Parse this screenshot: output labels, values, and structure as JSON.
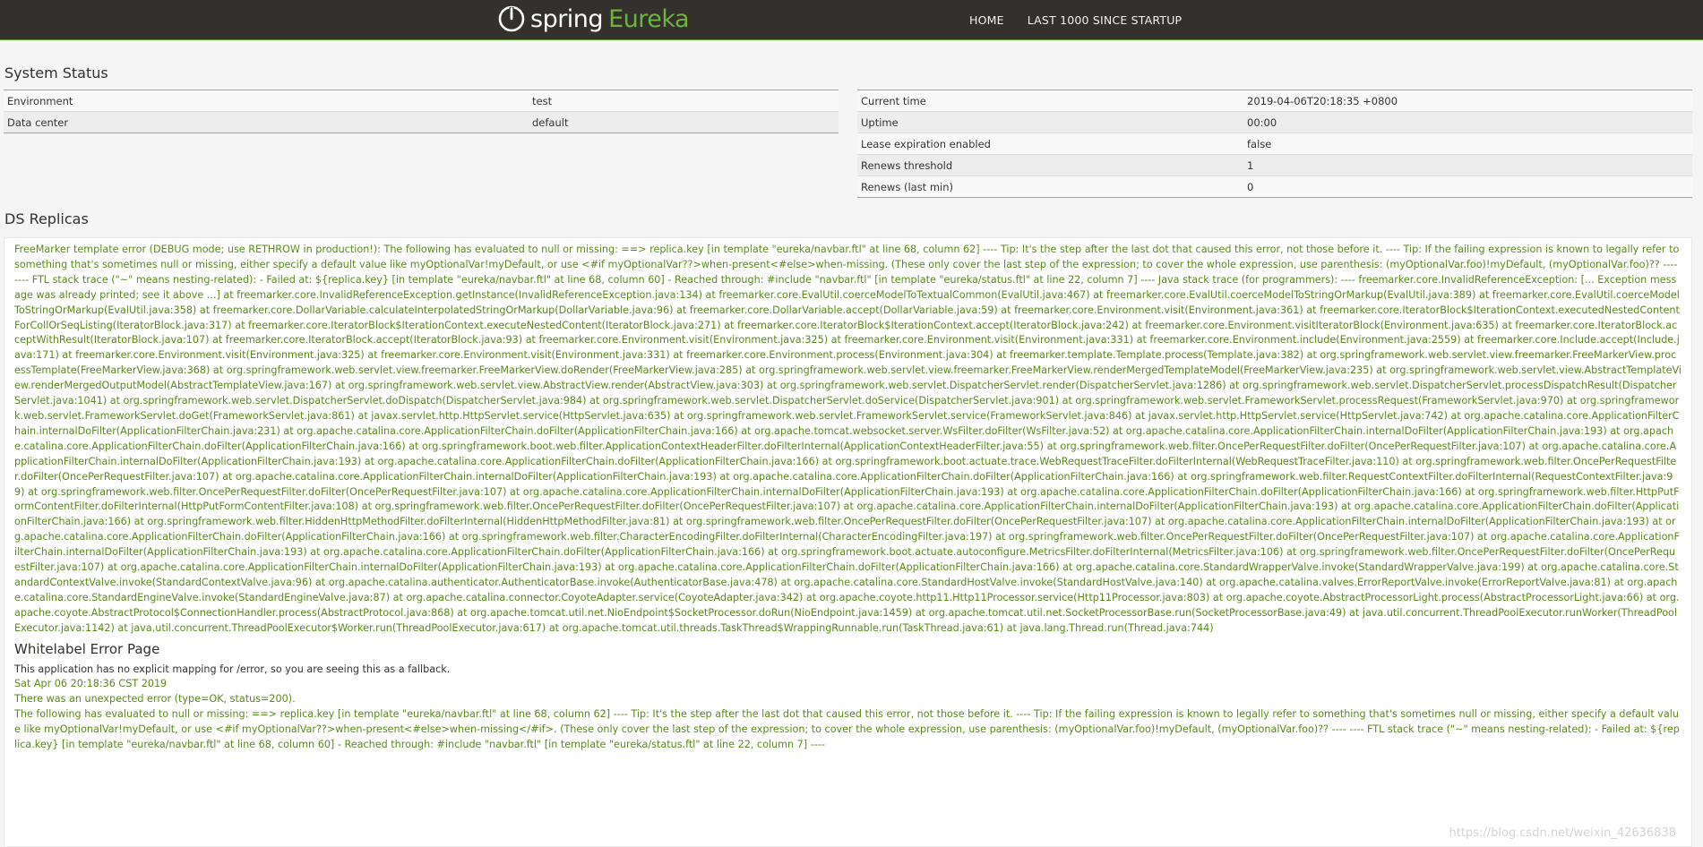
{
  "navbar": {
    "brand_spring": "spring",
    "brand_eureka": "Eureka",
    "links": [
      "HOME",
      "LAST 1000 SINCE STARTUP"
    ]
  },
  "system_status": {
    "title": "System Status",
    "left": [
      {
        "key": "Environment",
        "value": "test"
      },
      {
        "key": "Data center",
        "value": "default"
      }
    ],
    "right": [
      {
        "key": "Current time",
        "value": "2019-04-06T20:18:35 +0800"
      },
      {
        "key": "Uptime",
        "value": "00:00"
      },
      {
        "key": "Lease expiration enabled",
        "value": "false"
      },
      {
        "key": "Renews threshold",
        "value": "1"
      },
      {
        "key": "Renews (last min)",
        "value": "0"
      }
    ]
  },
  "replicas": {
    "title": "DS Replicas",
    "error_trace": "FreeMarker template error (DEBUG mode; use RETHROW in production!): The following has evaluated to null or missing: ==> replica.key [in template \"eureka/navbar.ftl\" at line 68, column 62] ---- Tip: It's the step after the last dot that caused this error, not those before it. ---- Tip: If the failing expression is known to legally refer to something that's sometimes null or missing, either specify a default value like myOptionalVar!myDefault, or use <#if myOptionalVar??>when-present<#else>when-missing. (These only cover the last step of the expression; to cover the whole expression, use parenthesis: (myOptionalVar.foo)!myDefault, (myOptionalVar.foo)?? ---- ---- FTL stack trace (\"~\" means nesting-related): - Failed at: ${replica.key} [in template \"eureka/navbar.ftl\" at line 68, column 60] - Reached through: #include \"navbar.ftl\" [in template \"eureka/status.ftl\" at line 22, column 7] ---- Java stack trace (for programmers): ---- freemarker.core.InvalidReferenceException: [... Exception message was already printed; see it above ...] at freemarker.core.InvalidReferenceException.getInstance(InvalidReferenceException.java:134) at freemarker.core.EvalUtil.coerceModelToTextualCommon(EvalUtil.java:467) at freemarker.core.EvalUtil.coerceModelToStringOrMarkup(EvalUtil.java:389) at freemarker.core.EvalUtil.coerceModelToStringOrMarkup(EvalUtil.java:358) at freemarker.core.DollarVariable.calculateInterpolatedStringOrMarkup(DollarVariable.java:96) at freemarker.core.DollarVariable.accept(DollarVariable.java:59) at freemarker.core.Environment.visit(Environment.java:361) at freemarker.core.IteratorBlock$IterationContext.executedNestedContentForCollOrSeqListing(IteratorBlock.java:317) at freemarker.core.IteratorBlock$IterationContext.executeNestedContent(IteratorBlock.java:271) at freemarker.core.IteratorBlock$IterationContext.accept(IteratorBlock.java:242) at freemarker.core.Environment.visitIteratorBlock(Environment.java:635) at freemarker.core.IteratorBlock.acceptWithResult(IteratorBlock.java:107) at freemarker.core.IteratorBlock.accept(IteratorBlock.java:93) at freemarker.core.Environment.visit(Environment.java:325) at freemarker.core.Environment.visit(Environment.java:331) at freemarker.core.Environment.include(Environment.java:2559) at freemarker.core.Include.accept(Include.java:171) at freemarker.core.Environment.visit(Environment.java:325) at freemarker.core.Environment.visit(Environment.java:331) at freemarker.core.Environment.process(Environment.java:304) at freemarker.template.Template.process(Template.java:382) at org.springframework.web.servlet.view.freemarker.FreeMarkerView.processTemplate(FreeMarkerView.java:368) at org.springframework.web.servlet.view.freemarker.FreeMarkerView.doRender(FreeMarkerView.java:285) at org.springframework.web.servlet.view.freemarker.FreeMarkerView.renderMergedTemplateModel(FreeMarkerView.java:235) at org.springframework.web.servlet.view.AbstractTemplateView.renderMergedOutputModel(AbstractTemplateView.java:167) at org.springframework.web.servlet.view.AbstractView.render(AbstractView.java:303) at org.springframework.web.servlet.DispatcherServlet.render(DispatcherServlet.java:1286) at org.springframework.web.servlet.DispatcherServlet.processDispatchResult(DispatcherServlet.java:1041) at org.springframework.web.servlet.DispatcherServlet.doDispatch(DispatcherServlet.java:984) at org.springframework.web.servlet.DispatcherServlet.doService(DispatcherServlet.java:901) at org.springframework.web.servlet.FrameworkServlet.processRequest(FrameworkServlet.java:970) at org.springframework.web.servlet.FrameworkServlet.doGet(FrameworkServlet.java:861) at javax.servlet.http.HttpServlet.service(HttpServlet.java:635) at org.springframework.web.servlet.FrameworkServlet.service(FrameworkServlet.java:846) at javax.servlet.http.HttpServlet.service(HttpServlet.java:742) at org.apache.catalina.core.ApplicationFilterChain.internalDoFilter(ApplicationFilterChain.java:231) at org.apache.catalina.core.ApplicationFilterChain.doFilter(ApplicationFilterChain.java:166) at org.apache.tomcat.websocket.server.WsFilter.doFilter(WsFilter.java:52) at org.apache.catalina.core.ApplicationFilterChain.internalDoFilter(ApplicationFilterChain.java:193) at org.apache.catalina.core.ApplicationFilterChain.doFilter(ApplicationFilterChain.java:166) at org.springframework.boot.web.filter.ApplicationContextHeaderFilter.doFilterInternal(ApplicationContextHeaderFilter.java:55) at org.springframework.web.filter.OncePerRequestFilter.doFilter(OncePerRequestFilter.java:107) at org.apache.catalina.core.ApplicationFilterChain.internalDoFilter(ApplicationFilterChain.java:193) at org.apache.catalina.core.ApplicationFilterChain.doFilter(ApplicationFilterChain.java:166) at org.springframework.boot.actuate.trace.WebRequestTraceFilter.doFilterInternal(WebRequestTraceFilter.java:110) at org.springframework.web.filter.OncePerRequestFilter.doFilter(OncePerRequestFilter.java:107) at org.apache.catalina.core.ApplicationFilterChain.internalDoFilter(ApplicationFilterChain.java:193) at org.apache.catalina.core.ApplicationFilterChain.doFilter(ApplicationFilterChain.java:166) at org.springframework.web.filter.RequestContextFilter.doFilterInternal(RequestContextFilter.java:99) at org.springframework.web.filter.OncePerRequestFilter.doFilter(OncePerRequestFilter.java:107) at org.apache.catalina.core.ApplicationFilterChain.internalDoFilter(ApplicationFilterChain.java:193) at org.apache.catalina.core.ApplicationFilterChain.doFilter(ApplicationFilterChain.java:166) at org.springframework.web.filter.HttpPutFormContentFilter.doFilterInternal(HttpPutFormContentFilter.java:108) at org.springframework.web.filter.OncePerRequestFilter.doFilter(OncePerRequestFilter.java:107) at org.apache.catalina.core.ApplicationFilterChain.internalDoFilter(ApplicationFilterChain.java:193) at org.apache.catalina.core.ApplicationFilterChain.doFilter(ApplicationFilterChain.java:166) at org.springframework.web.filter.HiddenHttpMethodFilter.doFilterInternal(HiddenHttpMethodFilter.java:81) at org.springframework.web.filter.OncePerRequestFilter.doFilter(OncePerRequestFilter.java:107) at org.apache.catalina.core.ApplicationFilterChain.internalDoFilter(ApplicationFilterChain.java:193) at org.apache.catalina.core.ApplicationFilterChain.doFilter(ApplicationFilterChain.java:166) at org.springframework.web.filter.CharacterEncodingFilter.doFilterInternal(CharacterEncodingFilter.java:197) at org.springframework.web.filter.OncePerRequestFilter.doFilter(OncePerRequestFilter.java:107) at org.apache.catalina.core.ApplicationFilterChain.internalDoFilter(ApplicationFilterChain.java:193) at org.apache.catalina.core.ApplicationFilterChain.doFilter(ApplicationFilterChain.java:166) at org.springframework.boot.actuate.autoconfigure.MetricsFilter.doFilterInternal(MetricsFilter.java:106) at org.springframework.web.filter.OncePerRequestFilter.doFilter(OncePerRequestFilter.java:107) at org.apache.catalina.core.ApplicationFilterChain.internalDoFilter(ApplicationFilterChain.java:193) at org.apache.catalina.core.ApplicationFilterChain.doFilter(ApplicationFilterChain.java:166) at org.apache.catalina.core.StandardWrapperValve.invoke(StandardWrapperValve.java:199) at org.apache.catalina.core.StandardContextValve.invoke(StandardContextValve.java:96) at org.apache.catalina.authenticator.AuthenticatorBase.invoke(AuthenticatorBase.java:478) at org.apache.catalina.core.StandardHostValve.invoke(StandardHostValve.java:140) at org.apache.catalina.valves.ErrorReportValve.invoke(ErrorReportValve.java:81) at org.apache.catalina.core.StandardEngineValve.invoke(StandardEngineValve.java:87) at org.apache.catalina.connector.CoyoteAdapter.service(CoyoteAdapter.java:342) at org.apache.coyote.http11.Http11Processor.service(Http11Processor.java:803) at org.apache.coyote.AbstractProcessorLight.process(AbstractProcessorLight.java:66) at org.apache.coyote.AbstractProtocol$ConnectionHandler.process(AbstractProtocol.java:868) at org.apache.tomcat.util.net.NioEndpoint$SocketProcessor.doRun(NioEndpoint.java:1459) at org.apache.tomcat.util.net.SocketProcessorBase.run(SocketProcessorBase.java:49) at java.util.concurrent.ThreadPoolExecutor.runWorker(ThreadPoolExecutor.java:1142) at java.util.concurrent.ThreadPoolExecutor$Worker.run(ThreadPoolExecutor.java:617) at org.apache.tomcat.util.threads.TaskThread$WrappingRunnable.run(TaskThread.java:61) at java.lang.Thread.run(Thread.java:744)"
  },
  "whitelabel": {
    "title": "Whitelabel Error Page",
    "line1": "This application has no explicit mapping for /error, so you are seeing this as a fallback.",
    "timestamp": "Sat Apr 06 20:18:36 CST 2019",
    "line3": "There was an unexpected error (type=OK, status=200).",
    "message": "The following has evaluated to null or missing: ==> replica.key [in template \"eureka/navbar.ftl\" at line 68, column 62] ---- Tip: It's the step after the last dot that caused this error, not those before it. ---- Tip: If the failing expression is known to legally refer to something that's sometimes null or missing, either specify a default value like myOptionalVar!myDefault, or use <#if myOptionalVar??>when-present<#else>when-missing</#if>. (These only cover the last step of the expression; to cover the whole expression, use parenthesis: (myOptionalVar.foo)!myDefault, (myOptionalVar.foo)?? ---- ---- FTL stack trace (\"~\" means nesting-related): - Failed at: ${replica.key} [in template \"eureka/navbar.ftl\" at line 68, column 60] - Reached through: #include \"navbar.ftl\" [in template \"eureka/status.ftl\" at line 22, column 7] ----"
  },
  "watermark": "https://blog.csdn.net/weixin_42636838",
  "colors": {
    "navbar_bg": "#34302d",
    "spring_green": "#6db33f",
    "error_text": "#5b8a1e"
  }
}
